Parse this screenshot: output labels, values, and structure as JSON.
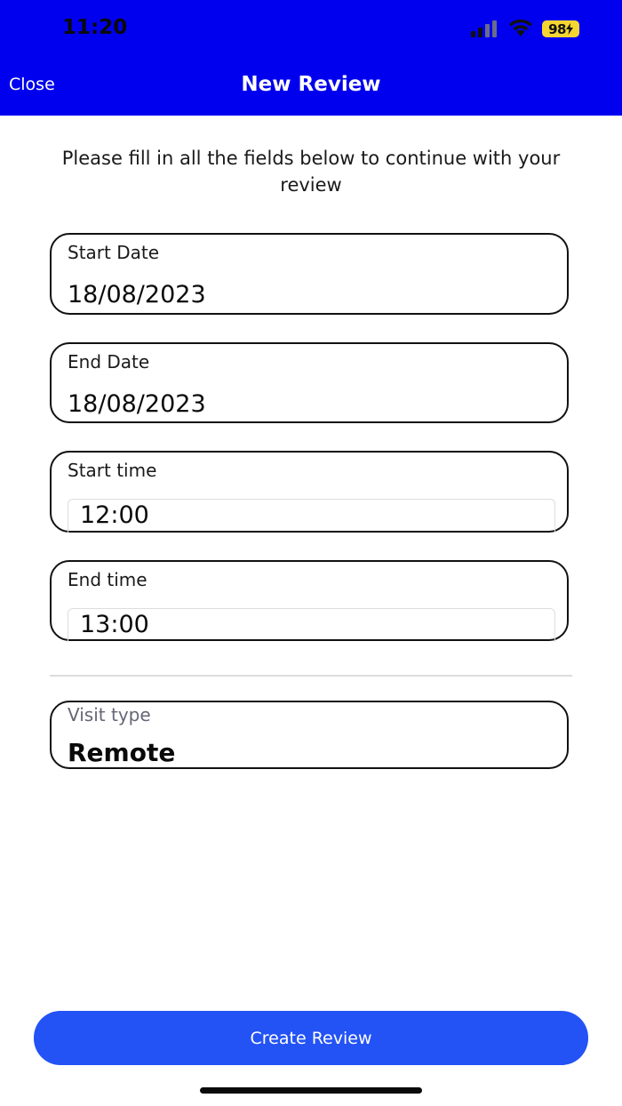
{
  "status_bar": {
    "time": "11:20",
    "battery": "98",
    "signal_icon": "cellular-signal-icon",
    "wifi_icon": "wifi-icon",
    "charging_icon": "bolt-icon"
  },
  "nav": {
    "close_label": "Close",
    "title": "New Review"
  },
  "instructions": "Please fill in all the fields below to continue with your review",
  "form": {
    "start_date": {
      "label": "Start Date",
      "value": "18/08/2023"
    },
    "end_date": {
      "label": "End Date",
      "value": "18/08/2023"
    },
    "start_time": {
      "label": "Start time",
      "value": "12:00"
    },
    "end_time": {
      "label": "End time",
      "value": "13:00"
    },
    "visit_type": {
      "label": "Visit type",
      "value": "Remote"
    }
  },
  "actions": {
    "create_label": "Create Review"
  },
  "colors": {
    "header_bg": "#0000ee",
    "primary_button": "#2353f5",
    "battery_fill": "#f5d531"
  }
}
